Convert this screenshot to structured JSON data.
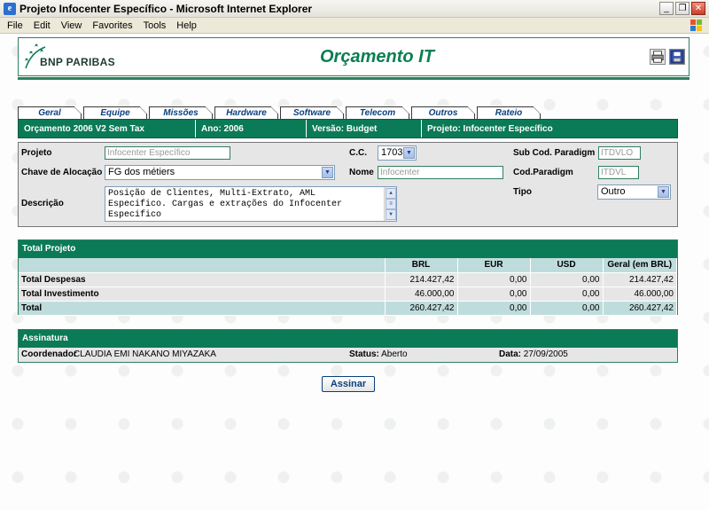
{
  "window": {
    "title": "Projeto Infocenter Específico - Microsoft Internet Explorer"
  },
  "menu": [
    "File",
    "Edit",
    "View",
    "Favorites",
    "Tools",
    "Help"
  ],
  "header": {
    "logo": "BNP PARIBAS",
    "app_title": "Orçamento IT"
  },
  "tabs": [
    "Geral",
    "Equipe",
    "Missões",
    "Hardware",
    "Software",
    "Telecom",
    "Outros",
    "Rateio"
  ],
  "info_bar": {
    "orcamento": "Orçamento 2006 V2 Sem Tax",
    "ano": "Ano: 2006",
    "versao": "Versão: Budget",
    "projeto": "Projeto: Infocenter Específico"
  },
  "form": {
    "projeto_label": "Projeto",
    "projeto_value": "Infocenter Específico",
    "cc_label": "C.C.",
    "cc_value": "1703",
    "subcod_label": "Sub Cod. Paradigm",
    "subcod_value": "ITDVLO",
    "chave_label": "Chave de Alocação",
    "chave_value": "FG dos métiers",
    "nome_label": "Nome",
    "nome_value": "Infocenter",
    "codpar_label": "Cod.Paradigm",
    "codpar_value": "ITDVL",
    "descricao_label": "Descrição",
    "descricao_line1": "Posição de Clientes, Multi-Extrato, AML",
    "descricao_line2": "Especifico. Cargas e extrações do Infocenter",
    "descricao_line3": "Especifico",
    "tipo_label": "Tipo",
    "tipo_value": "Outro"
  },
  "total": {
    "title": "Total Projeto",
    "columns": [
      "",
      "BRL",
      "EUR",
      "USD",
      "Geral (em BRL)"
    ],
    "rows": [
      {
        "label": "Total Despesas",
        "brl": "214.427,42",
        "eur": "0,00",
        "usd": "0,00",
        "geral": "214.427,42"
      },
      {
        "label": "Total Investimento",
        "brl": "46.000,00",
        "eur": "0,00",
        "usd": "0,00",
        "geral": "46.000,00"
      },
      {
        "label": "Total",
        "brl": "260.427,42",
        "eur": "0,00",
        "usd": "0,00",
        "geral": "260.427,42"
      }
    ]
  },
  "assinatura": {
    "title": "Assinatura",
    "coordenador_label": "Coordenador",
    "coordenador": "CLAUDIA EMI NAKANO MIYAZAKA",
    "status": "Status: Aberto",
    "data": "Data: 27/09/2005"
  },
  "assinar_button": "Assinar",
  "colors": {
    "accent": "#0b7a56",
    "title": "#0a7f52",
    "tab_text": "#0a3f7f"
  }
}
